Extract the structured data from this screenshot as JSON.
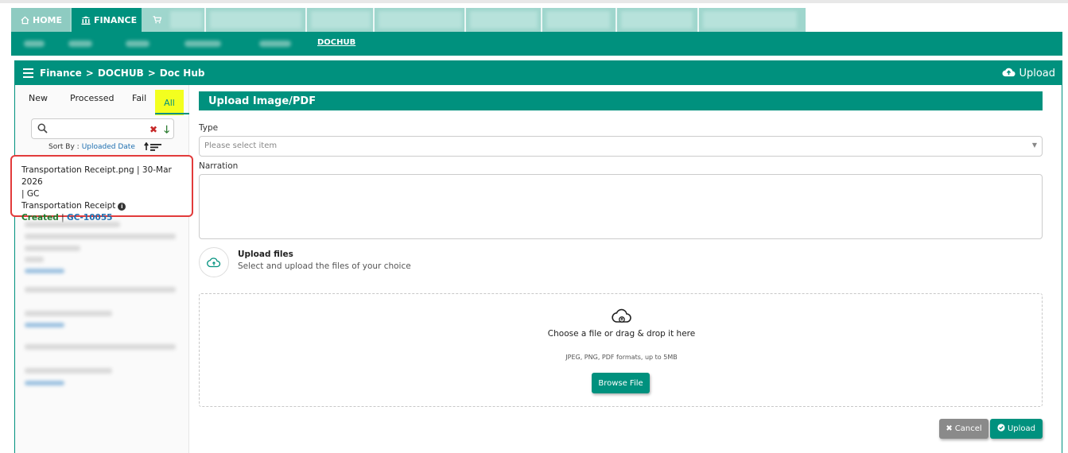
{
  "tabs": {
    "home": "HOME",
    "finance": "FINANCE"
  },
  "subnav": {
    "active": "DOCHUB"
  },
  "breadcrumb": {
    "root": "Finance",
    "sep": ">",
    "section": "DOCHUB",
    "page": "Doc Hub"
  },
  "header": {
    "upload_label": "Upload"
  },
  "filters": {
    "new": "New",
    "processed": "Processed",
    "fail": "Fail",
    "all": "All"
  },
  "sort": {
    "label": "Sort By :",
    "field": "Uploaded Date"
  },
  "document": {
    "line1": "Transportation Receipt.png | 30-Mar 2026",
    "line2": "| GC",
    "type": "Transportation Receipt",
    "status": "Created",
    "sep": "|",
    "code": "GC-10055"
  },
  "form": {
    "title": "Upload Image/PDF",
    "type_label": "Type",
    "type_placeholder": "Please select item",
    "narration_label": "Narration",
    "upload_title": "Upload files",
    "upload_sub": "Select and upload the files of your choice",
    "drop_title": "Choose a file or drag & drop it here",
    "drop_sub": "JPEG, PNG, PDF formats, up to 5MB",
    "browse": "Browse File",
    "cancel": "Cancel",
    "upload": "Upload"
  },
  "colors": {
    "brand": "#00917e",
    "highlight": "#f3ff1f",
    "status_ok": "#1b7a2b",
    "link": "#1e6fb0",
    "card_border": "#e23b3b"
  }
}
